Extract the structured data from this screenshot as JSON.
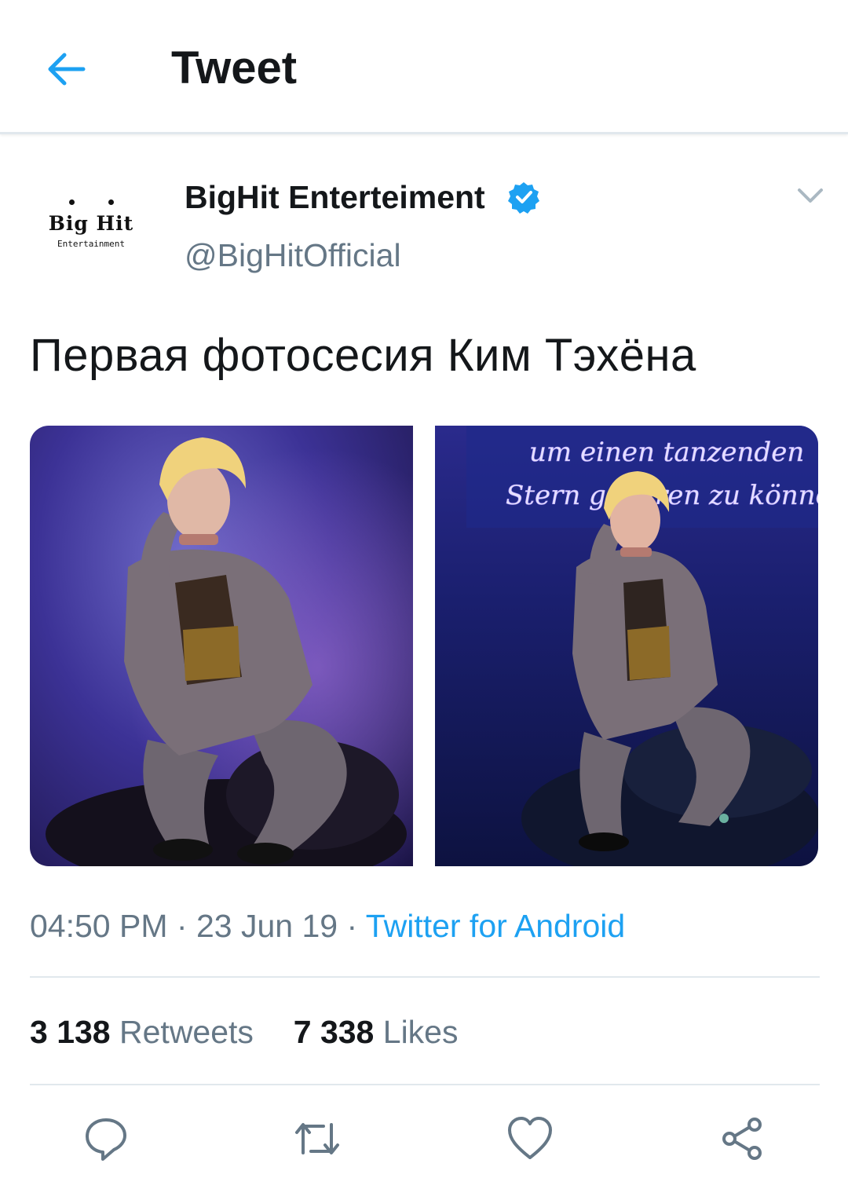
{
  "header": {
    "title": "Tweet",
    "back_icon": "arrow-left-icon"
  },
  "colors": {
    "accent": "#1da1f2",
    "text": "#14171a",
    "muted": "#657786",
    "divider": "#e1e8ed"
  },
  "author": {
    "avatar_brand": "Big Hit",
    "avatar_sub": "Entertainment",
    "name": "BigHit Enterteiment",
    "verified": true,
    "handle": "@BigHitOfficial"
  },
  "tweet": {
    "text": "Первая фотосесия Ким Тэхёна",
    "right_photo_neon_lines": [
      "um einen tanzenden",
      "Stern gebären zu können"
    ]
  },
  "meta": {
    "time": "04:50 PM",
    "separator": "·",
    "date": "23 Jun 19",
    "source": "Twitter for Android"
  },
  "stats": {
    "retweets_count": "3 138",
    "retweets_label": "Retweets",
    "likes_count": "7 338",
    "likes_label": "Likes"
  },
  "actions": [
    "reply-icon",
    "retweet-icon",
    "like-icon",
    "share-icon"
  ]
}
